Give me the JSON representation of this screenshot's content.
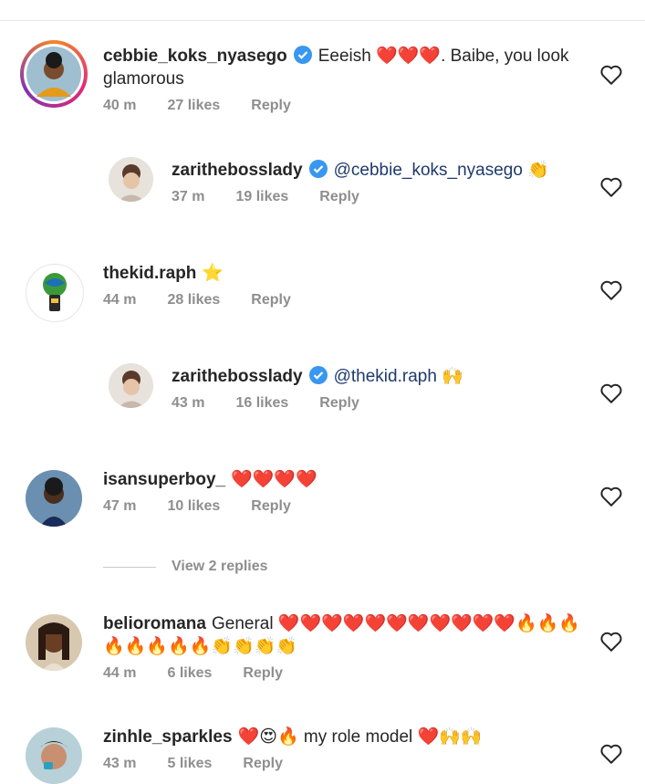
{
  "comments": [
    {
      "username": "cebbie_koks_nyasego",
      "verified": true,
      "text": "Eeeish ❤️❤️❤️. Baibe, you look glamorous",
      "time": "40 m",
      "likes": "27 likes",
      "reply": "Reply"
    },
    {
      "username": "zarithebosslady",
      "verified": true,
      "mention": "@cebbie_koks_nyasego",
      "text": "👏",
      "time": "37 m",
      "likes": "19 likes",
      "reply": "Reply"
    },
    {
      "username": "thekid.raph",
      "verified": false,
      "text": "⭐",
      "time": "44 m",
      "likes": "28 likes",
      "reply": "Reply"
    },
    {
      "username": "zarithebosslady",
      "verified": true,
      "mention": "@thekid.raph",
      "text": "🙌",
      "time": "43 m",
      "likes": "16 likes",
      "reply": "Reply"
    },
    {
      "username": "isansuperboy_",
      "verified": false,
      "text": "❤️❤️❤️❤️",
      "time": "47 m",
      "likes": "10 likes",
      "reply": "Reply"
    },
    {
      "username": "belioromana",
      "verified": false,
      "text": "General ❤️❤️❤️❤️❤️❤️❤️❤️❤️❤️❤️🔥🔥🔥🔥🔥🔥🔥🔥👏👏👏👏",
      "time": "44 m",
      "likes": "6 likes",
      "reply": "Reply"
    },
    {
      "username": "zinhle_sparkles",
      "verified": false,
      "text": "❤️😍🔥 my role model ❤️🙌🙌",
      "time": "43 m",
      "likes": "5 likes",
      "reply": "Reply"
    }
  ],
  "view_replies": "View 2 replies",
  "colors": {
    "verified": "#3897f0",
    "meta": "#8e8e8e",
    "mention": "#1e3a6e",
    "heart_red": "#e3202e"
  }
}
